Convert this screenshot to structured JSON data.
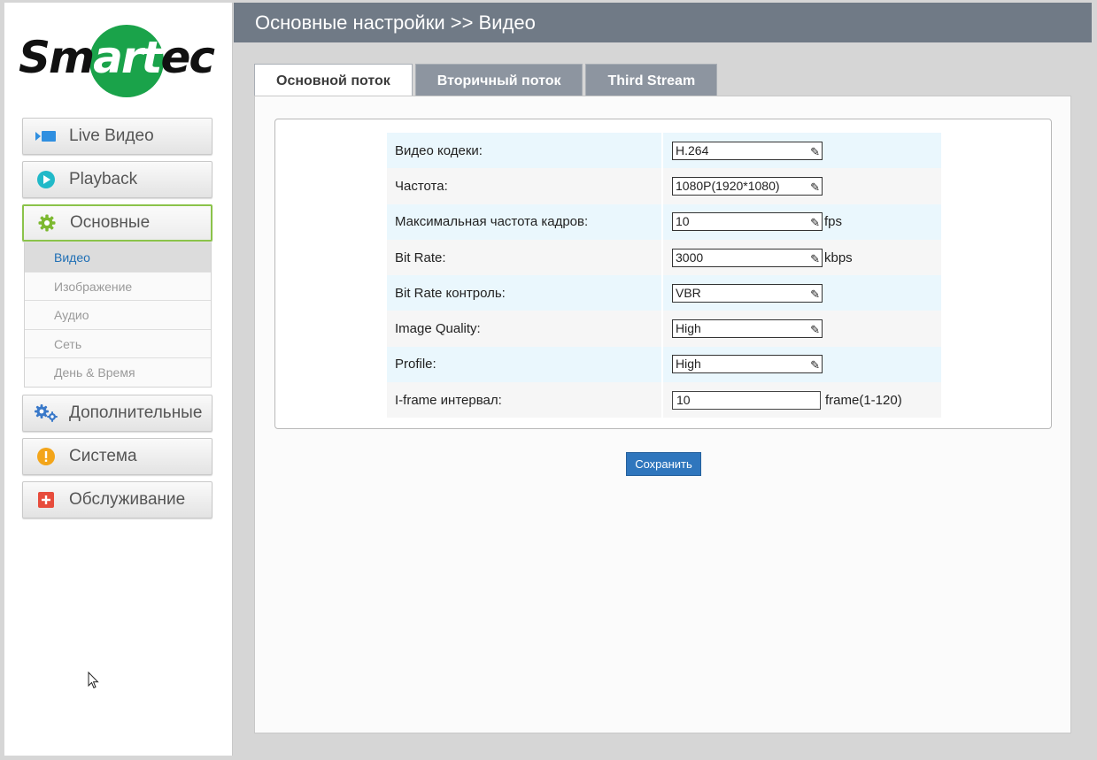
{
  "logo": {
    "part1": "Sm",
    "part2": "art",
    "part3": "ec"
  },
  "sidebar": {
    "items": [
      {
        "label": "Live Видео",
        "icon": "live-video-icon",
        "color": "#2f8fe0"
      },
      {
        "label": "Playback",
        "icon": "play-circle-icon",
        "color": "#21b9c8"
      },
      {
        "label": "Основные",
        "icon": "gear-icon",
        "color": "#7cb82f"
      },
      {
        "label": "Дополнительные",
        "icon": "gears-icon",
        "color": "#3a79c9"
      },
      {
        "label": "Система",
        "icon": "alert-circle-icon",
        "color": "#f3a51a"
      },
      {
        "label": "Обслуживание",
        "icon": "plus-square-icon",
        "color": "#e74c3c"
      }
    ],
    "submenu": [
      "Видео",
      "Изображение",
      "Аудио",
      "Сеть",
      "День & Время"
    ]
  },
  "header": {
    "title": "Основные настройки >> Видео"
  },
  "tabs": [
    "Основной поток",
    "Вторичный поток",
    "Third Stream"
  ],
  "form": {
    "rows": [
      {
        "label": "Видео кодеки:",
        "value": "H.264",
        "unit": ""
      },
      {
        "label": "Частота:",
        "value": "1080P(1920*1080)",
        "unit": ""
      },
      {
        "label": "Максимальная частота кадров:",
        "value": "10",
        "unit": "fps"
      },
      {
        "label": "Bit Rate:",
        "value": "3000",
        "unit": "kbps"
      },
      {
        "label": "Bit Rate контроль:",
        "value": "VBR",
        "unit": ""
      },
      {
        "label": "Image Quality:",
        "value": "High",
        "unit": ""
      },
      {
        "label": "Profile:",
        "value": "High",
        "unit": ""
      },
      {
        "label": "I-frame интервал:",
        "value": "10",
        "unit": "frame(1-120)"
      }
    ],
    "save_label": "Сохранить"
  },
  "accent": "#2f76bd"
}
